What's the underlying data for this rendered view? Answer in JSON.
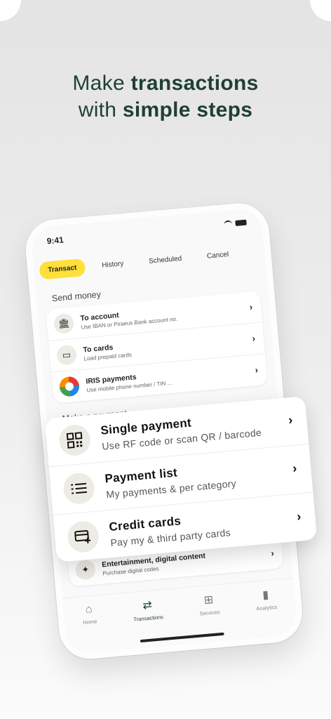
{
  "headline": {
    "line1_prefix": "Make ",
    "line1_bold": "transactions",
    "line2_prefix": "with ",
    "line2_bold": "simple steps"
  },
  "status": {
    "time": "9:41"
  },
  "tabs": [
    "Transact",
    "History",
    "Scheduled",
    "Cancel"
  ],
  "send_money": {
    "title": "Send money",
    "items": [
      {
        "title": "To account",
        "subtitle": "Use IBAN or Piraeus Bank account no.",
        "icon": "bank-icon"
      },
      {
        "title": "To cards",
        "subtitle": "Load prepaid cards",
        "icon": "card-icon"
      },
      {
        "title": "IRIS payments",
        "subtitle": "Use mobile phone number / TIN ...",
        "icon": "iris-logo"
      }
    ]
  },
  "make_payment": {
    "title": "Make a payment",
    "items": [
      {
        "title": "Single payment",
        "subtitle": "Use RF code or scan QR / barcode",
        "icon": "qr-icon"
      },
      {
        "title": "Payment list",
        "subtitle": "My payments & per category",
        "icon": "list-icon"
      },
      {
        "title": "Credit cards",
        "subtitle": "Pay my & third party cards",
        "icon": "add-card-icon"
      }
    ]
  },
  "entertainment": {
    "title": "Entertainment, digital content",
    "subtitle": "Purchase digital codes",
    "icon": "party-icon"
  },
  "bottom_nav": [
    {
      "label": "Home",
      "icon": "home-icon"
    },
    {
      "label": "Transactions",
      "icon": "transfer-icon"
    },
    {
      "label": "Services",
      "icon": "services-icon"
    },
    {
      "label": "Analytics",
      "icon": "analytics-icon"
    }
  ],
  "colors": {
    "accent": "#ffe03a",
    "brand_dark": "#1f3f38"
  }
}
